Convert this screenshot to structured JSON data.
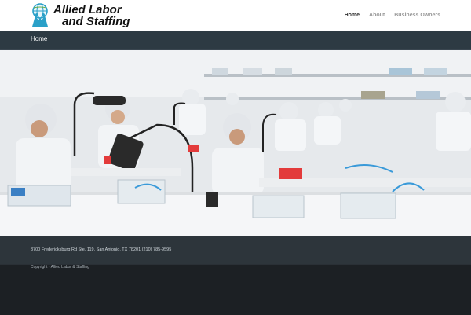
{
  "brand": {
    "line1": "Allied Labor",
    "line2": "and Staffing"
  },
  "nav": {
    "items": [
      {
        "label": "Home",
        "active": true
      },
      {
        "label": "About",
        "active": false
      },
      {
        "label": "Business Owners",
        "active": false
      }
    ]
  },
  "page": {
    "title": "Home"
  },
  "footer": {
    "address": "3700 Fredericksburg Rd Ste. 119, San Antonio, TX 78201 (210) 785-9595",
    "copyright": "Copyright - Allied Labor & Staffing"
  },
  "colors": {
    "header_bg": "#ffffff",
    "titlebar_bg": "#2d3a43",
    "footer_bg": "#2d353b",
    "copyright_bg": "#1c2024",
    "logo_accent": "#2aa0c8"
  }
}
